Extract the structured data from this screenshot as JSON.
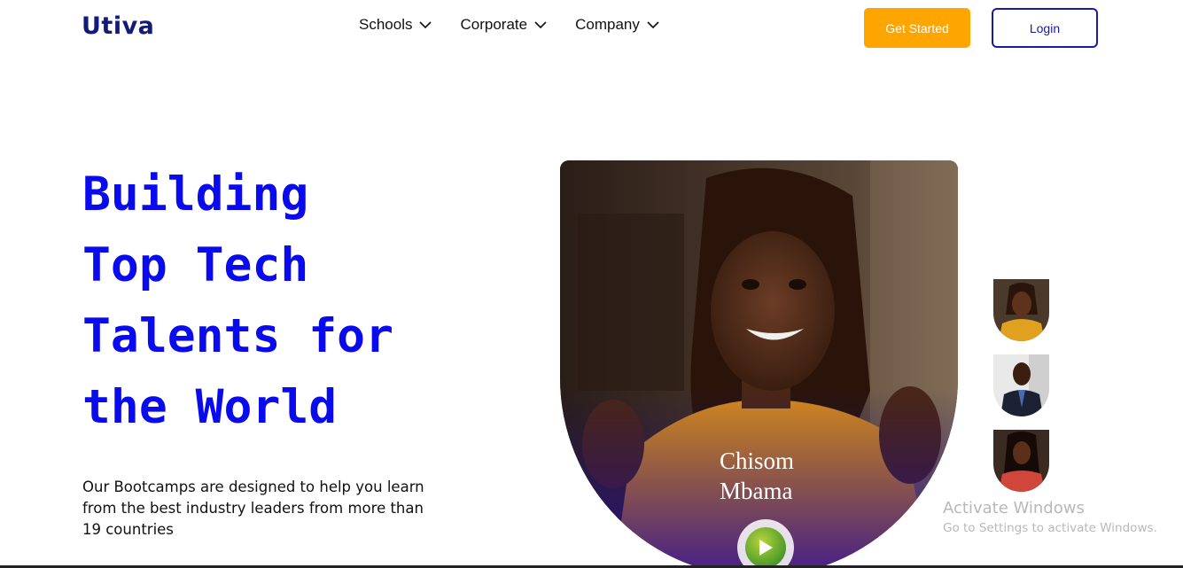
{
  "brand": {
    "name": "Utiva",
    "color": "#121a7a"
  },
  "nav": {
    "items": [
      {
        "label": "Schools"
      },
      {
        "label": "Corporate"
      },
      {
        "label": "Company"
      }
    ]
  },
  "actions": {
    "get_started_label": "Get Started",
    "login_label": "Login",
    "accent_color": "#ffa500",
    "login_color": "#1a1aa8"
  },
  "hero": {
    "title_lines": [
      "Building",
      "Top Tech",
      "Talents for",
      "the World"
    ],
    "title_color": "#0a0aee",
    "subtitle": "Our Bootcamps are designed to help you learn from the best industry leaders from more than 19 countries"
  },
  "video": {
    "person_name_line1": "Chisom",
    "person_name_line2": "Mbama",
    "play_icon": "play-icon"
  },
  "thumbnails": [
    {
      "icon": "avatar-woman-yellow"
    },
    {
      "icon": "avatar-man-suit"
    },
    {
      "icon": "avatar-woman-red"
    }
  ],
  "watermark": {
    "title": "Activate Windows",
    "subtitle": "Go to Settings to activate Windows."
  }
}
